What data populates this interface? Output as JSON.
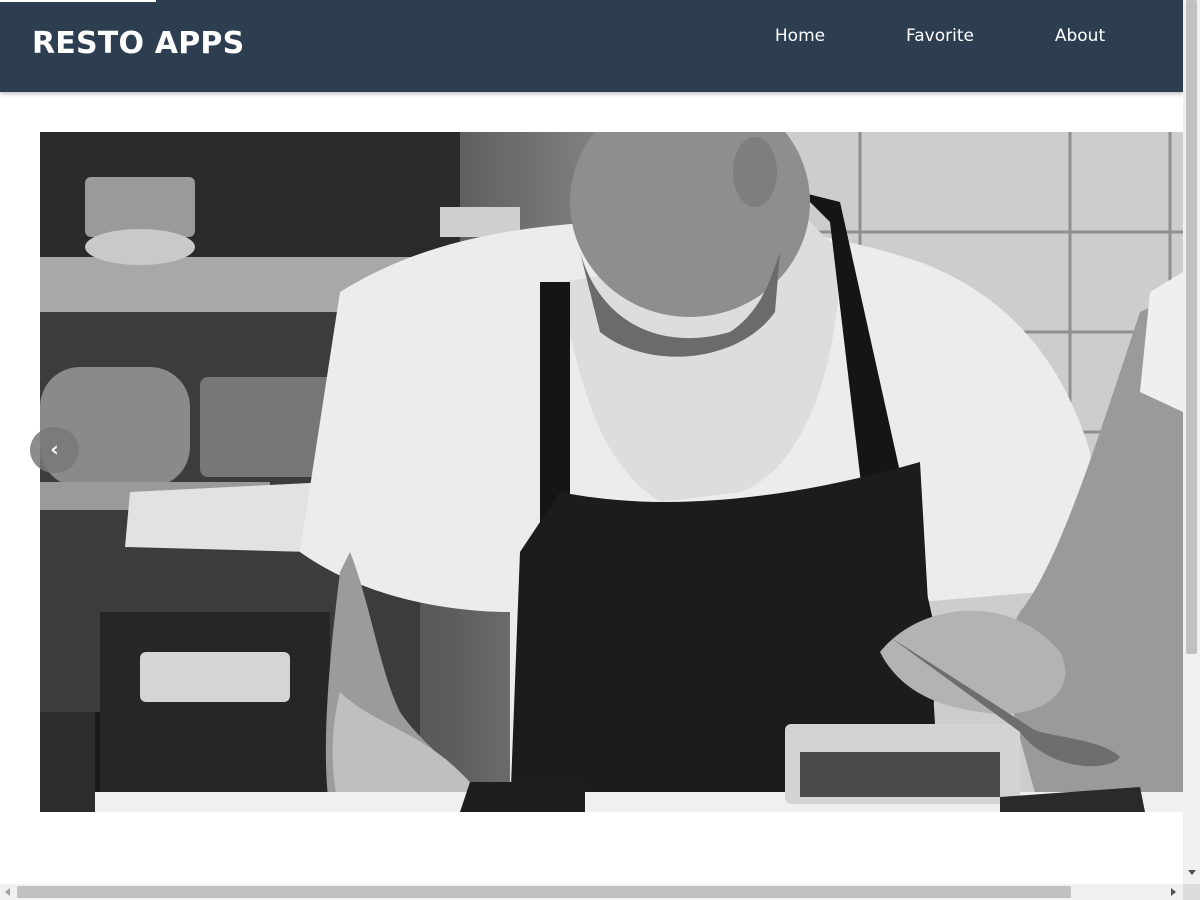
{
  "header": {
    "brand": "RESTO APPS",
    "nav": [
      {
        "label": "Home"
      },
      {
        "label": "Favorite"
      },
      {
        "label": "About"
      }
    ],
    "background_color": "#2c3e50"
  },
  "hero": {
    "image": "chef-plating-food-black-and-white",
    "prev_label": "‹",
    "prev_icon": "chevron-left-icon"
  },
  "colors": {
    "header_bg": "#2c3e50",
    "text_on_header": "#ffffff",
    "page_bg": "#ffffff"
  }
}
